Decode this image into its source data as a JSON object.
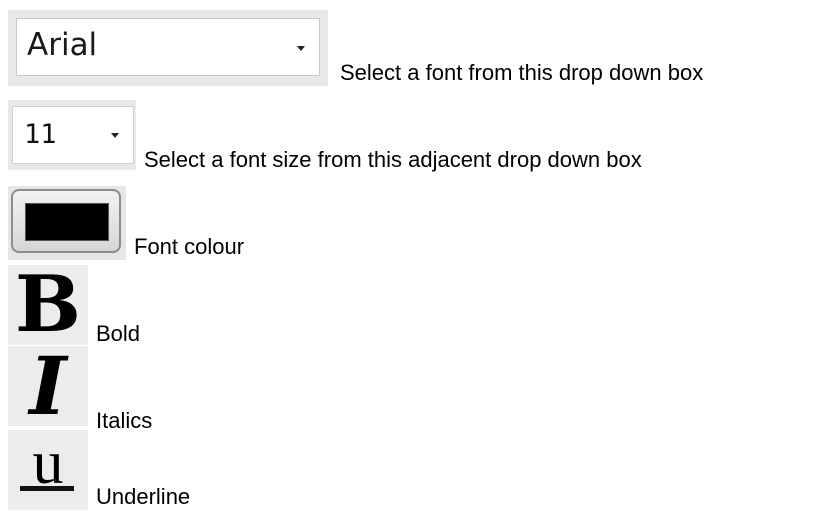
{
  "font_selector": {
    "value": "Arial",
    "caption": "Select a font from this drop down box"
  },
  "size_selector": {
    "value": "11",
    "caption": "Select a font size from this adjacent drop down box"
  },
  "colour_button": {
    "swatch_color": "#000000",
    "caption": "Font colour"
  },
  "bold_button": {
    "glyph": "B",
    "caption": "Bold"
  },
  "italic_button": {
    "glyph": "I",
    "caption": "Italics"
  },
  "underline_button": {
    "glyph": "u",
    "caption": "Underline"
  },
  "icons": {
    "dropdown_arrow": "chevron-down-icon",
    "bold": "bold-icon",
    "italic": "italic-icon",
    "underline": "underline-icon"
  }
}
